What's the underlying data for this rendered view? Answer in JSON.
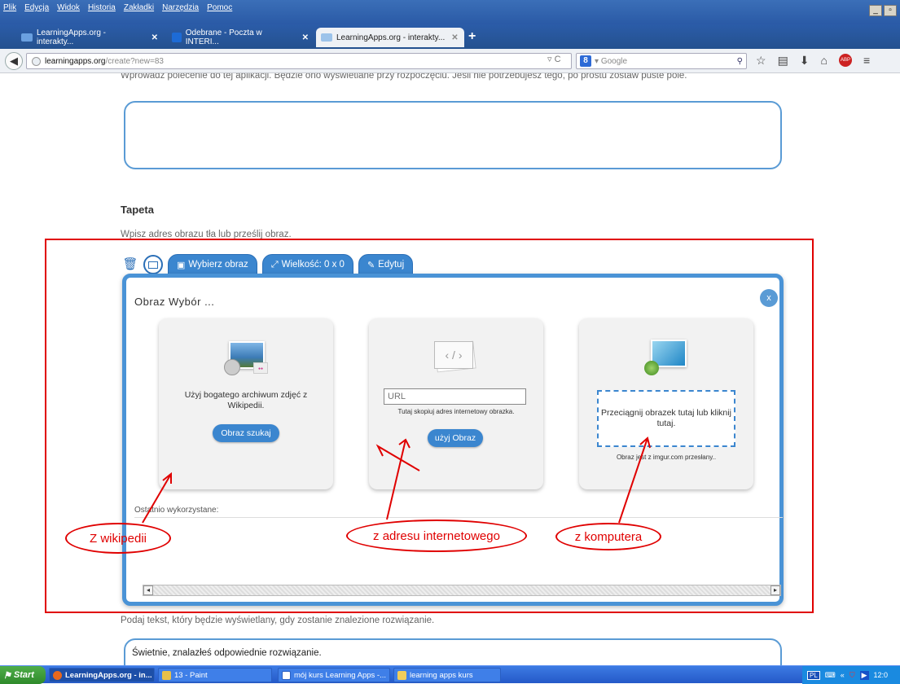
{
  "browser": {
    "menu": [
      "Plik",
      "Edycja",
      "Widok",
      "Historia",
      "Zakładki",
      "Narzędzia",
      "Pomoc"
    ],
    "tabs": [
      {
        "label": "LearningApps.org - interakty...",
        "active": false
      },
      {
        "label": "Odebrane - Poczta w INTERI...",
        "active": false
      },
      {
        "label": "LearningApps.org - interakty...",
        "active": true
      }
    ],
    "new_tab": "+",
    "url_domain": "learningapps.org",
    "url_path": "/create?new=83",
    "search_placeholder": "Google"
  },
  "page": {
    "top_instruction": "Wprowadź polecenie do tej aplikacji. Będzie ono wyświetlane przy rozpoczęciu. Jeśli nie potrzebujesz tego, po prostu zostaw puste pole.",
    "section_title": "Tapeta",
    "section_instruction": "Wpisz adres obrazu tła lub prześlij obraz.",
    "toolbar": {
      "choose_image": "Wybierz obraz",
      "size": "Wielkość: 0 x 0",
      "edit": "Edytuj"
    },
    "panel": {
      "title": "Obraz Wybór ...",
      "close": "x",
      "cards": {
        "wikipedia": {
          "description": "Użyj bogatego archiwum zdjęć z Wikipedii.",
          "button": "Obraz szukaj"
        },
        "url": {
          "placeholder": "URL",
          "note": "Tutaj skopiuj adres internetowy obrazka.",
          "button": "użyj Obraz"
        },
        "computer": {
          "drop_text": "Przeciągnij obrazek tutaj lub kliknij tutaj.",
          "note": "Obraz jest z imgur.com przesłany.."
        }
      },
      "recent_label": "Ostatnio wykorzystane:"
    },
    "success_instruction": "Podaj tekst, który będzie wyświetlany, gdy zostanie znalezione rozwiązanie.",
    "success_text": "Świetnie, znalazłeś odpowiednie rozwiązanie."
  },
  "annotations": {
    "wikipedia": "Z wikipedii",
    "url": "z adresu internetowego",
    "computer": "z komputera"
  },
  "taskbar": {
    "start": "Start",
    "tasks": [
      {
        "label": "LearningApps.org - in...",
        "active": true
      },
      {
        "label": "13 - Paint",
        "active": false
      },
      {
        "label": "mój kurs Learning Apps -...",
        "active": false
      },
      {
        "label": "learning apps kurs",
        "active": false
      }
    ],
    "language": "PL",
    "clock": "12:0"
  },
  "colors": {
    "accent": "#3b86cf",
    "annotation_red": "#e00000",
    "titlebar": "#2a5aa6"
  }
}
